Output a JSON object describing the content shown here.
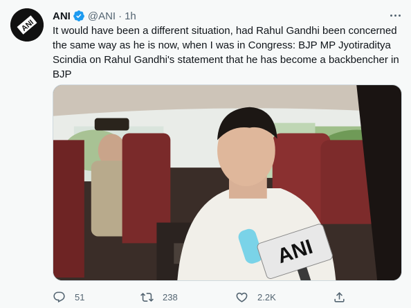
{
  "tweet": {
    "author_name": "ANI",
    "handle": "@ANI",
    "separator": "·",
    "time": "1h",
    "avatar_text": "ANI",
    "text": "It would have been a different situation, had Rahul Gandhi been concerned the same way as he is now, when I was in Congress: BJP MP Jyotiraditya Scindia on Rahul Gandhi's statement that he has become a backbencher in BJP",
    "media_mic_label": "ANI"
  },
  "actions": {
    "replies": "51",
    "retweets": "238",
    "likes": "2.2K"
  },
  "icons": {
    "verified": "verified-badge-icon",
    "more": "more-dots-icon",
    "reply": "reply-icon",
    "retweet": "retweet-icon",
    "like": "heart-icon",
    "share": "share-icon"
  },
  "colors": {
    "verified": "#1d9bf0",
    "text": "#0f1419",
    "secondary": "#536471",
    "background": "#f7f9f9"
  }
}
